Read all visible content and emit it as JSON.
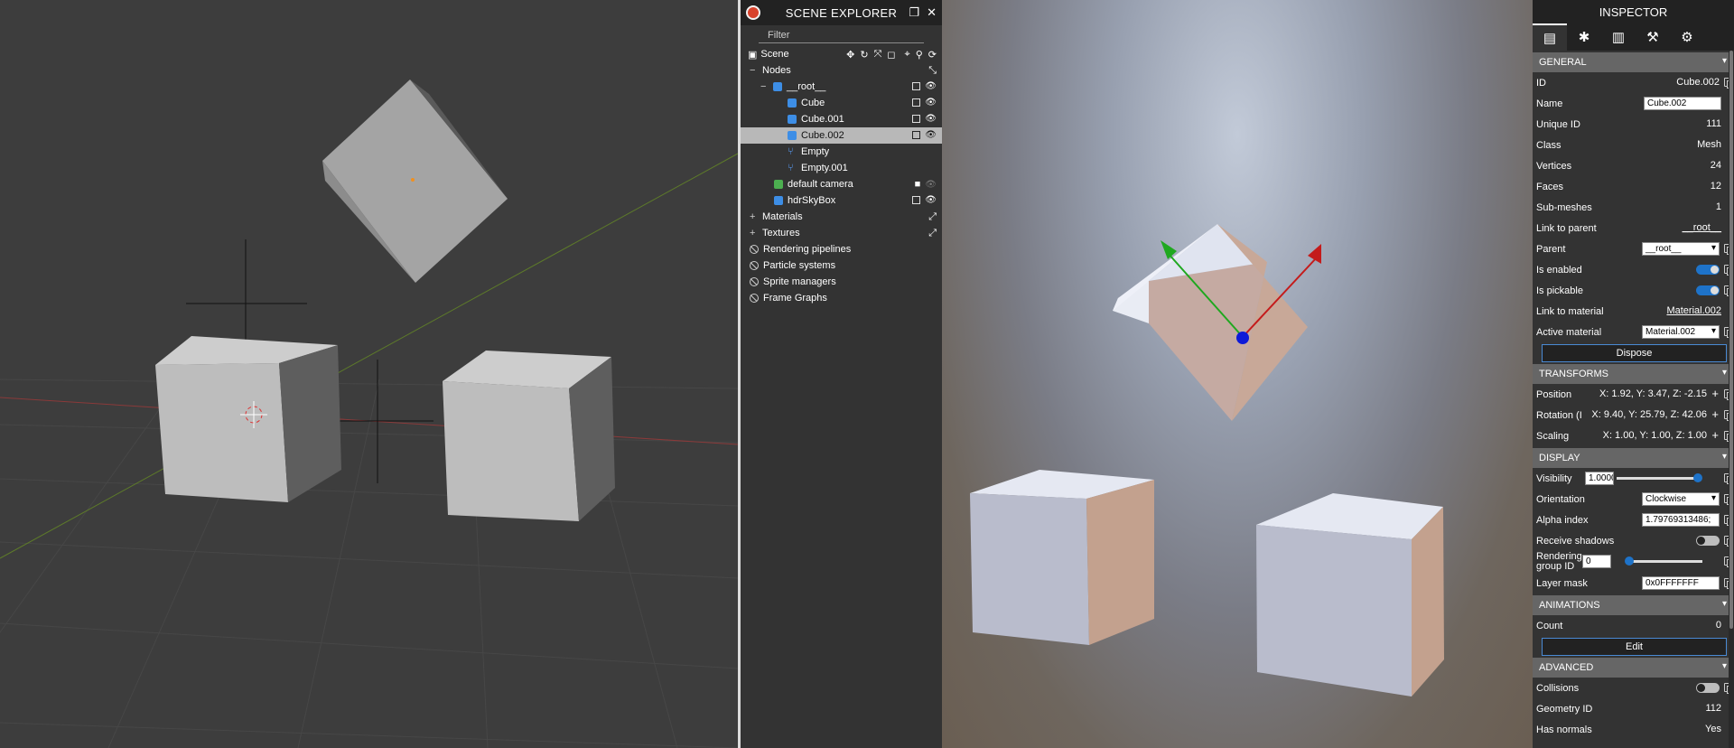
{
  "explorer": {
    "title": "SCENE EXPLORER",
    "filter_placeholder": "Filter",
    "scene_label": "Scene",
    "nodes_label": "Nodes",
    "root_label": "__root__",
    "items": [
      {
        "label": "Cube",
        "kind": "mesh"
      },
      {
        "label": "Cube.001",
        "kind": "mesh"
      },
      {
        "label": "Cube.002",
        "kind": "mesh",
        "selected": true
      },
      {
        "label": "Empty",
        "kind": "empty"
      },
      {
        "label": "Empty.001",
        "kind": "empty"
      }
    ],
    "camera_label": "default camera",
    "skybox_label": "hdrSkyBox",
    "materials_label": "Materials",
    "textures_label": "Textures",
    "rendering_pipelines_label": "Rendering pipelines",
    "particle_systems_label": "Particle systems",
    "sprite_managers_label": "Sprite managers",
    "frame_graphs_label": "Frame Graphs"
  },
  "inspector": {
    "title": "INSPECTOR",
    "general": {
      "header": "GENERAL",
      "id_label": "ID",
      "id_value": "Cube.002",
      "name_label": "Name",
      "name_value": "Cube.002",
      "unique_id_label": "Unique ID",
      "unique_id_value": "111",
      "class_label": "Class",
      "class_value": "Mesh",
      "vertices_label": "Vertices",
      "vertices_value": "24",
      "faces_label": "Faces",
      "faces_value": "12",
      "submeshes_label": "Sub-meshes",
      "submeshes_value": "1",
      "link_parent_label": "Link to parent",
      "link_parent_value": "__root__",
      "parent_label": "Parent",
      "parent_value": "__root__",
      "is_enabled_label": "Is enabled",
      "is_pickable_label": "Is pickable",
      "link_material_label": "Link to material",
      "link_material_value": "Material.002",
      "active_material_label": "Active material",
      "active_material_value": "Material.002",
      "dispose_label": "Dispose"
    },
    "transforms": {
      "header": "TRANSFORMS",
      "position_label": "Position",
      "position_value": "X: 1.92, Y: 3.47, Z: -2.15",
      "rotation_label": "Rotation (I",
      "rotation_value": "X: 9.40, Y: 25.79, Z: 42.06",
      "scaling_label": "Scaling",
      "scaling_value": "X: 1.00, Y: 1.00, Z: 1.00"
    },
    "display": {
      "header": "DISPLAY",
      "visibility_label": "Visibility",
      "visibility_value": "1.0000",
      "orientation_label": "Orientation",
      "orientation_value": "Clockwise",
      "alpha_index_label": "Alpha index",
      "alpha_index_value": "1.79769313486;",
      "receive_shadows_label": "Receive shadows",
      "rendering_group_label_1": "Rendering",
      "rendering_group_label_2": "group ID",
      "rendering_group_value": "0",
      "layer_mask_label": "Layer mask",
      "layer_mask_value": "0x0FFFFFFF"
    },
    "animations": {
      "header": "ANIMATIONS",
      "count_label": "Count",
      "count_value": "0",
      "edit_label": "Edit"
    },
    "advanced": {
      "header": "ADVANCED",
      "collisions_label": "Collisions",
      "geometry_id_label": "Geometry ID",
      "geometry_id_value": "112",
      "has_normals_label": "Has normals",
      "has_normals_value": "Yes"
    }
  },
  "colors": {
    "panel_bg": "#333333",
    "header_bg": "#222222",
    "section_bg": "#666666",
    "accent": "#1e73c9",
    "cube_icon": "#3d8ee6"
  }
}
